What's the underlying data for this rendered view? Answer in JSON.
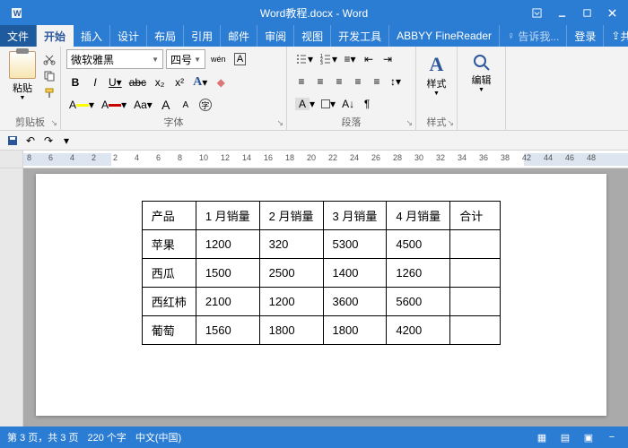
{
  "titlebar": {
    "title": "Word教程.docx - Word"
  },
  "menu": {
    "file": "文件",
    "home": "开始",
    "insert": "插入",
    "design": "设计",
    "layout": "布局",
    "ref": "引用",
    "mail": "邮件",
    "review": "审阅",
    "view": "视图",
    "dev": "开发工具",
    "abbyy": "ABBYY FineReader",
    "tell": "告诉我...",
    "login": "登录",
    "share": "共享"
  },
  "ribbon": {
    "clipboard": {
      "paste": "粘贴",
      "label": "剪贴板"
    },
    "font": {
      "name": "微软雅黑",
      "size": "四号",
      "grow": "A",
      "shrink": "A",
      "clearfmt": "Aa",
      "bold": "B",
      "italic": "I",
      "underline": "U",
      "strike": "abc",
      "sub": "x₂",
      "sup": "x²",
      "phonetic": "wén",
      "charborder": "A",
      "label": "字体"
    },
    "para": {
      "label": "段落"
    },
    "style": {
      "btn": "样式",
      "label": "样式"
    },
    "edit": {
      "btn": "编辑"
    }
  },
  "ruler": {
    "ticks": [
      8,
      6,
      4,
      2,
      2,
      4,
      6,
      8,
      10,
      12,
      14,
      16,
      18,
      20,
      22,
      24,
      26,
      28,
      30,
      32,
      34,
      36,
      38,
      42,
      44,
      46,
      48
    ]
  },
  "table": {
    "headers": [
      "产品",
      "1 月销量",
      "2 月销量",
      "3 月销量",
      "4 月销量",
      "合计"
    ],
    "rows": [
      [
        "苹果",
        "1200",
        "320",
        "5300",
        "4500",
        ""
      ],
      [
        "西瓜",
        "1500",
        "2500",
        "1400",
        "1260",
        ""
      ],
      [
        "西红柿",
        "2100",
        "1200",
        "3600",
        "5600",
        ""
      ],
      [
        "葡萄",
        "1560",
        "1800",
        "1800",
        "4200",
        ""
      ]
    ]
  },
  "status": {
    "page": "第 3 页，共 3 页",
    "words": "220 个字",
    "lang": "中文(中国)"
  }
}
